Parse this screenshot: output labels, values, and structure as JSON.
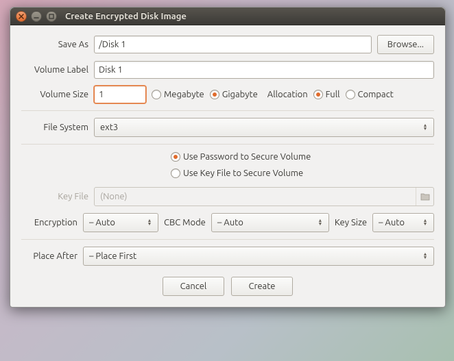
{
  "window": {
    "title": "Create Encrypted Disk Image"
  },
  "fields": {
    "save_as": {
      "label": "Save As",
      "value": "/Disk 1",
      "browse": "Browse..."
    },
    "volume_label": {
      "label": "Volume Label",
      "value": "Disk 1"
    },
    "volume_size": {
      "label": "Volume Size",
      "value": "1",
      "unit_mb": "Megabyte",
      "unit_gb": "Gigabyte",
      "allocation_label": "Allocation",
      "alloc_full": "Full",
      "alloc_compact": "Compact"
    },
    "filesystem": {
      "label": "File System",
      "value": "ext3"
    },
    "secure": {
      "password": "Use Password to Secure Volume",
      "keyfile": "Use Key File to Secure Volume"
    },
    "keyfile": {
      "label": "Key File",
      "placeholder": "(None)"
    },
    "encryption": {
      "label": "Encryption",
      "value": "– Auto",
      "cbc_label": "CBC Mode",
      "cbc_value": "– Auto",
      "keysize_label": "Key Size",
      "keysize_value": "– Auto"
    },
    "place_after": {
      "label": "Place After",
      "value": "– Place First"
    }
  },
  "buttons": {
    "cancel": "Cancel",
    "create": "Create"
  }
}
